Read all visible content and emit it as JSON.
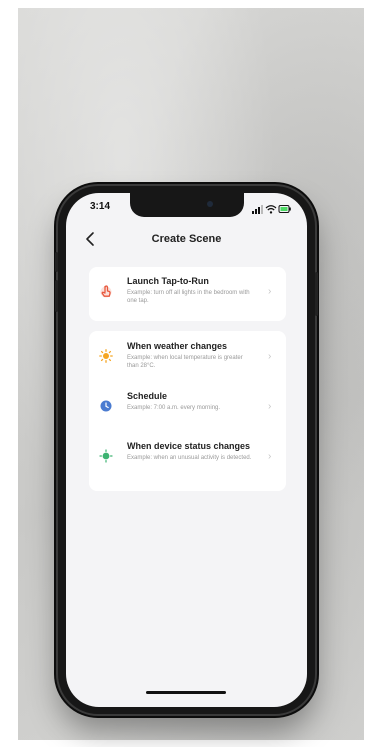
{
  "status_bar": {
    "time": "3:14"
  },
  "header": {
    "back_label": "<",
    "title": "Create Scene"
  },
  "groups": [
    {
      "items": [
        {
          "title": "Launch Tap-to-Run",
          "description": "Example: turn off all lights in the bedroom with one tap.",
          "icon": "hand-tap-icon",
          "color": "#e8573c"
        }
      ]
    },
    {
      "items": [
        {
          "title": "When weather changes",
          "description": "Example: when local temperature is greater than 28°C.",
          "icon": "sun-icon",
          "color": "#f5a623"
        },
        {
          "title": "Schedule",
          "description": "Example: 7:00 a.m. every morning.",
          "icon": "clock-icon",
          "color": "#4a7bd0"
        },
        {
          "title": "When device status changes",
          "description": "Example: when an unusual activity is detected.",
          "icon": "device-status-icon",
          "color": "#3cb371"
        }
      ]
    }
  ],
  "chevron": "›"
}
